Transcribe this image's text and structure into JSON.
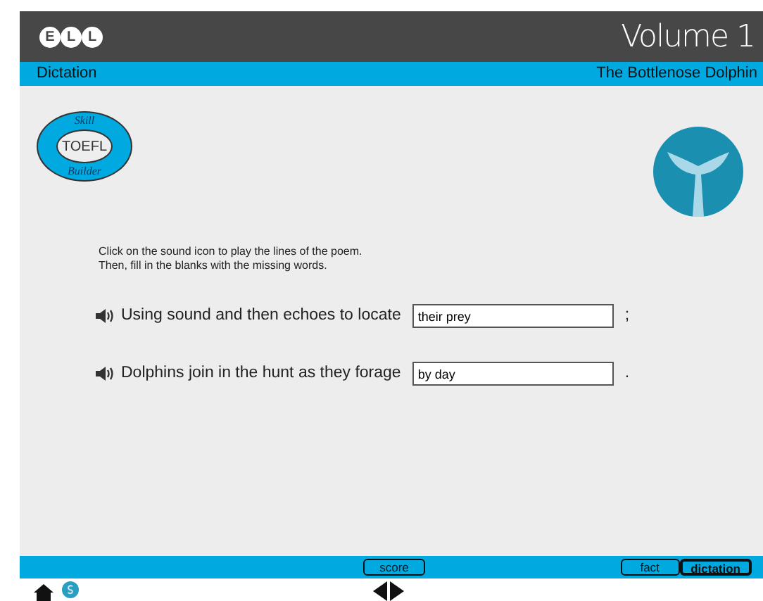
{
  "header": {
    "logo_letters": [
      "E",
      "L",
      "L"
    ],
    "volume": "Volume 1"
  },
  "subheader": {
    "section": "Dictation",
    "topic": "The Bottlenose Dolphin"
  },
  "badge": {
    "top": "Skill",
    "center": "TOEFL",
    "bottom": "Builder"
  },
  "instructions": [
    "Click on the sound icon to play the lines of the poem.",
    "Then, fill in the blanks with the missing words."
  ],
  "lines": [
    {
      "text": "Using sound and then echoes to locate",
      "value": "their prey",
      "punctuation": ";"
    },
    {
      "text": "Dolphins join in the hunt as they forage",
      "value": "by day",
      "punctuation": "."
    }
  ],
  "footer": {
    "score": "score",
    "tabs": [
      {
        "label": "fact",
        "selected": false
      },
      {
        "label": "dictation",
        "selected": true
      }
    ]
  }
}
